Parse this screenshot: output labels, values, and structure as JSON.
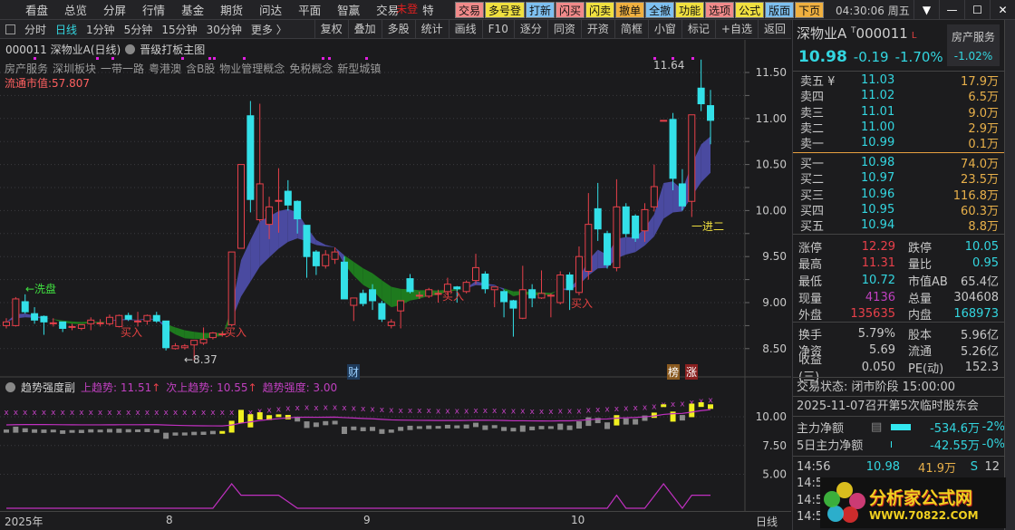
{
  "menubar": {
    "items": [
      "看盘",
      "总览",
      "分屏",
      "行情",
      "基金",
      "期货",
      "问达",
      "平面",
      "智赢"
    ],
    "trade": "交易",
    "trade_overlay": "未登",
    "trade_overlay2": "特",
    "buttons": [
      {
        "label": "交易",
        "color": "pink"
      },
      {
        "label": "多号登",
        "color": "yel"
      },
      {
        "label": "打新",
        "color": "blue"
      },
      {
        "label": "闪买",
        "color": "pink"
      },
      {
        "label": "闪卖",
        "color": "yel"
      },
      {
        "label": "撤单",
        "color": "org"
      },
      {
        "label": "全撤",
        "color": "blue"
      },
      {
        "label": "功能",
        "color": "yel"
      },
      {
        "label": "选项",
        "color": "pink"
      },
      {
        "label": "公式",
        "color": "yel"
      },
      {
        "label": "版面",
        "color": "blue"
      },
      {
        "label": "下页",
        "color": "org"
      }
    ],
    "clock": "04:30:06 周五",
    "win": [
      "👕",
      "—",
      "☐",
      "✕"
    ]
  },
  "toolbar": {
    "periods": [
      "分时",
      "日线",
      "1分钟",
      "5分钟",
      "15分钟",
      "30分钟",
      "更多 〉"
    ],
    "active": "日线",
    "tools": [
      "复权",
      "叠加",
      "多股",
      "统计",
      "画线",
      "F10",
      "逐分",
      "同资",
      "开资",
      "简框",
      "小窗",
      "标记",
      "+自选",
      "返回"
    ]
  },
  "chart": {
    "title": "000011 深物业A(日线)",
    "template": "晋级打板主图",
    "concepts": [
      "房产服务",
      "深圳板块",
      "一带一路",
      "粤港澳",
      "含B股",
      "物业管理概念",
      "免税概念",
      "新型城镇"
    ],
    "market_cap": "流通市值:57.807",
    "annotations": {
      "wash": "←洗盘",
      "buy": "买入",
      "low": "←8.37",
      "high": "11.64",
      "promo": "一进二",
      "fin": "财",
      "rank": "榜",
      "up": "涨"
    },
    "sub": {
      "name": "趋势强度副",
      "up": "上趋势: 11.51",
      "up_arrow": "↑",
      "next": "次上趋势: 10.55",
      "strength": "趋势强度: 3.00"
    },
    "xaxis": {
      "year": "2025年",
      "m8": "8",
      "m9": "9",
      "m10": "10",
      "period": "日线"
    }
  },
  "chart_data": {
    "type": "candlestick",
    "ylim": [
      8.3,
      11.7
    ],
    "yticks": [
      "11.50",
      "11.00",
      "10.50",
      "10.00",
      "9.50",
      "9.00",
      "8.50"
    ],
    "sub_yticks": [
      "10.00",
      "7.50",
      "5.00"
    ],
    "ohlc": [
      [
        8.75,
        8.83,
        8.72,
        8.79
      ],
      [
        8.75,
        9.06,
        8.74,
        9.04
      ],
      [
        9.01,
        9.09,
        8.88,
        8.9
      ],
      [
        8.88,
        8.95,
        8.77,
        8.81
      ],
      [
        8.85,
        8.86,
        8.65,
        8.79
      ],
      [
        8.78,
        8.83,
        8.74,
        8.78
      ],
      [
        8.79,
        8.79,
        8.68,
        8.72
      ],
      [
        8.74,
        8.77,
        8.7,
        8.74
      ],
      [
        8.72,
        8.76,
        8.7,
        8.76
      ],
      [
        8.77,
        8.84,
        8.7,
        8.81
      ],
      [
        8.78,
        8.82,
        8.74,
        8.78
      ],
      [
        8.77,
        8.87,
        8.75,
        8.84
      ],
      [
        8.74,
        8.87,
        8.73,
        8.86
      ],
      [
        8.86,
        8.89,
        8.8,
        8.82
      ],
      [
        8.8,
        8.9,
        8.74,
        8.8
      ],
      [
        8.8,
        8.87,
        8.76,
        8.86
      ],
      [
        8.86,
        8.9,
        8.78,
        8.8
      ],
      [
        8.8,
        8.8,
        8.48,
        8.51
      ],
      [
        8.5,
        8.56,
        8.49,
        8.53
      ],
      [
        8.51,
        8.55,
        8.49,
        8.53
      ],
      [
        8.54,
        8.59,
        8.37,
        8.59
      ],
      [
        8.56,
        8.73,
        8.54,
        8.6
      ],
      [
        8.62,
        8.68,
        8.6,
        8.67
      ],
      [
        8.66,
        8.69,
        8.63,
        8.66
      ],
      [
        8.76,
        9.55,
        8.74,
        9.55
      ],
      [
        9.59,
        10.5,
        9.59,
        10.5
      ],
      [
        11.03,
        11.19,
        9.98,
        10.12
      ],
      [
        9.9,
        11.16,
        9.88,
        10.29
      ],
      [
        9.85,
        10.15,
        9.69,
        10.04
      ],
      [
        10.11,
        10.46,
        9.76,
        10.11
      ],
      [
        10.21,
        10.33,
        10.0,
        10.06
      ],
      [
        10.1,
        10.11,
        9.75,
        9.91
      ],
      [
        9.84,
        9.84,
        9.27,
        9.5
      ],
      [
        9.55,
        9.57,
        9.3,
        9.4
      ],
      [
        9.4,
        9.57,
        9.37,
        9.52
      ],
      [
        9.47,
        9.6,
        9.42,
        9.55
      ],
      [
        9.44,
        9.5,
        9.04,
        9.04
      ],
      [
        8.97,
        9.05,
        8.8,
        9.05
      ],
      [
        9.1,
        9.14,
        8.96,
        8.99
      ],
      [
        9.14,
        9.2,
        8.92,
        9.02
      ],
      [
        8.99,
        9.02,
        8.79,
        8.82
      ],
      [
        8.75,
        8.82,
        8.72,
        8.79
      ],
      [
        8.91,
        9.02,
        8.72,
        9.02
      ],
      [
        9.26,
        9.31,
        9.1,
        9.12
      ],
      [
        9.08,
        9.12,
        9.04,
        9.08
      ],
      [
        9.07,
        9.16,
        9.05,
        9.14
      ],
      [
        9.1,
        9.14,
        9.0,
        9.1
      ],
      [
        9.12,
        9.27,
        9.08,
        9.2
      ],
      [
        9.17,
        9.18,
        9.0,
        9.15
      ],
      [
        9.12,
        9.24,
        9.1,
        9.22
      ],
      [
        9.24,
        9.53,
        9.2,
        9.38
      ],
      [
        9.31,
        9.34,
        9.1,
        9.15
      ],
      [
        9.14,
        9.17,
        8.95,
        9.17
      ],
      [
        9.12,
        9.14,
        8.84,
        9.01
      ],
      [
        9.02,
        9.03,
        8.63,
        8.94
      ],
      [
        8.83,
        9.4,
        8.82,
        9.14
      ],
      [
        9.14,
        9.2,
        8.95,
        9.05
      ],
      [
        9.05,
        9.35,
        9.04,
        9.1
      ],
      [
        9.08,
        9.1,
        8.84,
        9.08
      ],
      [
        9.0,
        9.34,
        8.98,
        9.3
      ],
      [
        9.3,
        9.33,
        8.92,
        9.14
      ],
      [
        9.11,
        9.61,
        9.08,
        9.5
      ],
      [
        9.34,
        10.19,
        9.25,
        9.85
      ],
      [
        10.02,
        10.3,
        9.67,
        9.8
      ],
      [
        9.75,
        9.78,
        9.37,
        9.41
      ],
      [
        9.38,
        10.34,
        9.34,
        10.04
      ],
      [
        10.04,
        10.08,
        9.71,
        9.75
      ],
      [
        9.94,
        9.96,
        9.66,
        9.7
      ],
      [
        9.78,
        10.08,
        9.66,
        10.01
      ],
      [
        10.04,
        10.5,
        9.99,
        10.26
      ],
      [
        10.98,
        10.98,
        10.98,
        10.98
      ],
      [
        10.99,
        11.06,
        10.22,
        10.35
      ],
      [
        10.29,
        10.45,
        10.0,
        10.05
      ],
      [
        10.1,
        11.04,
        9.93,
        11.04
      ],
      [
        11.33,
        11.64,
        11.08,
        11.16
      ],
      [
        11.14,
        11.31,
        10.72,
        10.98
      ]
    ],
    "strength": [
      0,
      0,
      0,
      0,
      0,
      0,
      0,
      0,
      0,
      0,
      0,
      0,
      0,
      0,
      0,
      0,
      0,
      0,
      0,
      0,
      0,
      0,
      0,
      1.5,
      3,
      1.6,
      1.6,
      1.6,
      1.6,
      1.6,
      0.8,
      0,
      0,
      0,
      0,
      0,
      0,
      0,
      0,
      0,
      0,
      0,
      0,
      0,
      0,
      0,
      0,
      0,
      0,
      0,
      0,
      0,
      0,
      0,
      0,
      0,
      0,
      0,
      0,
      0,
      0,
      0,
      0,
      0,
      0,
      1.6,
      0,
      0,
      0,
      1.5,
      3,
      1.5,
      0,
      1.6,
      1.6,
      1.6
    ],
    "colors": {
      "up": "#e8404a",
      "down": "#33e0e8",
      "ribbon_up": "#4a4aa0",
      "ribbon_down": "#1e7a1e",
      "sub_line": "#c030c0"
    }
  },
  "quote": {
    "name": "深物业A",
    "t": "T",
    "code": "000011",
    "flag": "L",
    "sector": "房产服务",
    "sector_change": "-1.02%",
    "price": "10.98",
    "change": "-0.19",
    "pct": "-1.70%",
    "sell": [
      {
        "label": "卖五 ¥",
        "price": "11.03",
        "vol": "17.9万"
      },
      {
        "label": "卖四",
        "price": "11.02",
        "vol": "6.5万"
      },
      {
        "label": "卖三",
        "price": "11.01",
        "vol": "9.0万"
      },
      {
        "label": "卖二",
        "price": "11.00",
        "vol": "2.9万"
      },
      {
        "label": "卖一",
        "price": "10.99",
        "vol": "0.1万"
      }
    ],
    "buy": [
      {
        "label": "买一",
        "price": "10.98",
        "vol": "74.0万"
      },
      {
        "label": "买二",
        "price": "10.97",
        "vol": "23.5万"
      },
      {
        "label": "买三",
        "price": "10.96",
        "vol": "116.8万"
      },
      {
        "label": "买四",
        "price": "10.95",
        "vol": "60.3万"
      },
      {
        "label": "买五",
        "price": "10.94",
        "vol": "8.8万"
      }
    ],
    "stats1": [
      [
        "涨停",
        "12.29",
        "red",
        "跌停",
        "10.05",
        "cyan"
      ],
      [
        "最高",
        "11.31",
        "red",
        "量比",
        "0.95",
        "cyan"
      ],
      [
        "最低",
        "10.72",
        "cyan",
        "市值AB",
        "65.4亿",
        "wt"
      ],
      [
        "现量",
        "4136",
        "mag",
        "总量",
        "304608",
        "wt"
      ],
      [
        "外盘",
        "135635",
        "red",
        "内盘",
        "168973",
        "cyan"
      ]
    ],
    "stats2": [
      [
        "换手",
        "5.79%",
        "wt",
        "股本",
        "5.96亿",
        "wt"
      ],
      [
        "净资",
        "5.69",
        "wt",
        "流通",
        "5.26亿",
        "wt"
      ],
      [
        "收益(三)",
        "0.050",
        "wt",
        "PE(动)",
        "152.3",
        "wt"
      ]
    ],
    "status": "交易状态: 闭市阶段 15:00:00",
    "notice": "2025-11-07召开第5次临时股东会",
    "flow": [
      {
        "label": "主力净额",
        "amount": "-534.6万",
        "pct": "-2%"
      },
      {
        "label": "5日主力净额",
        "amount": "-42.55万",
        "pct": "-0%"
      }
    ],
    "ticks": [
      {
        "time": "14:56",
        "price": "10.98",
        "vol": "41.9万",
        "side": "S",
        "n": "12"
      },
      {
        "time": "14:56"
      },
      {
        "time": "14:56"
      },
      {
        "time": "14:57"
      }
    ]
  },
  "logo": {
    "title": "分析家公式网",
    "url": "WWW.70822.COM"
  }
}
